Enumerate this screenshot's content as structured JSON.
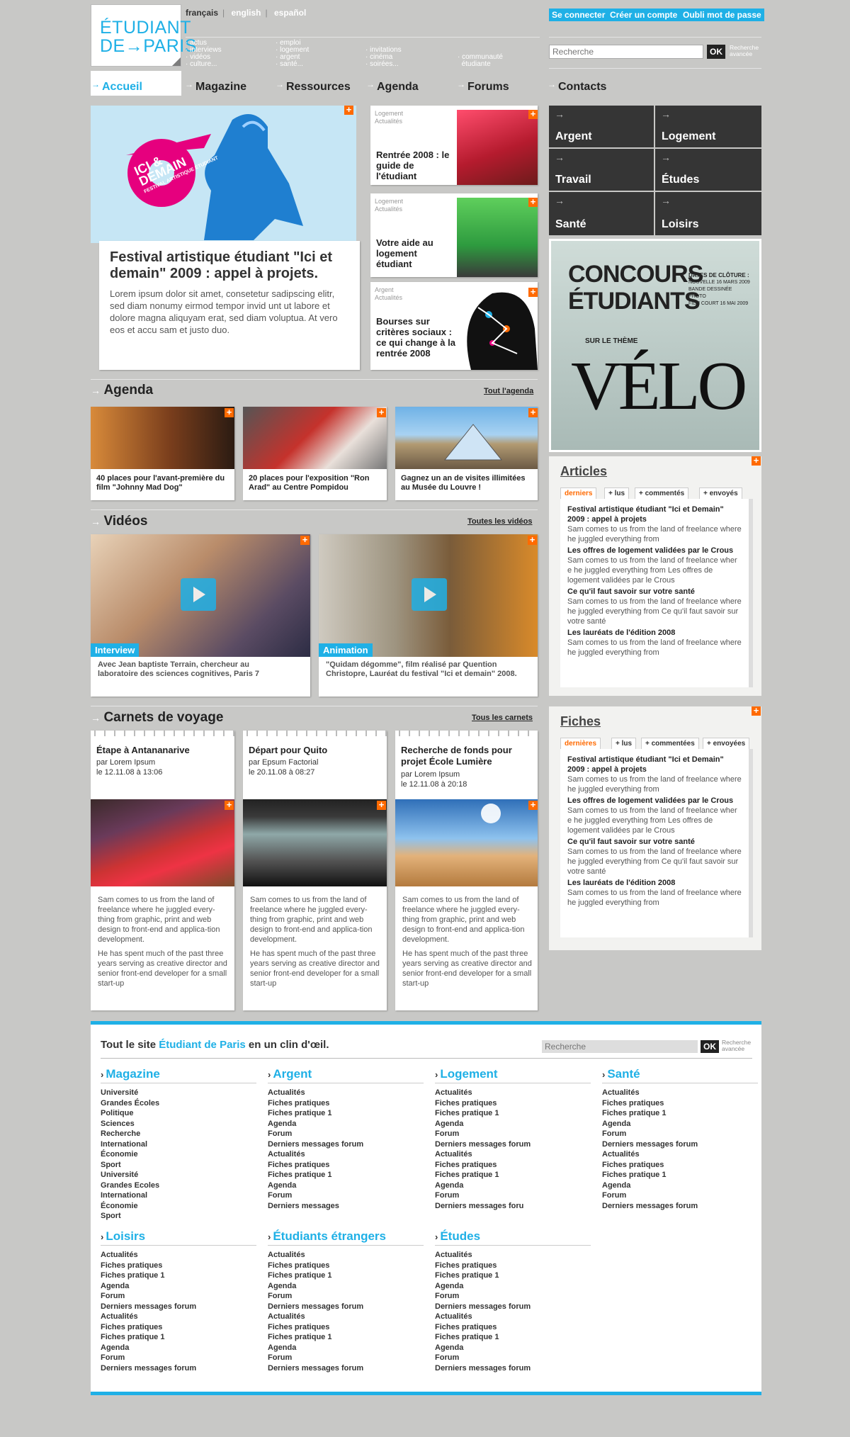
{
  "brand": {
    "line1": "ÉTUDIANT",
    "line2": "DE→PARIS"
  },
  "langs": [
    "français",
    "english",
    "español"
  ],
  "header_links": [
    [
      "actus",
      "interviews",
      "vidéos",
      "culture..."
    ],
    [
      "emploi",
      "logement",
      "argent",
      "santé..."
    ],
    [
      "invitations",
      "cinéma",
      "soirées..."
    ],
    [
      "communauté",
      "étudiante"
    ]
  ],
  "account": {
    "login": "Se connecter",
    "create": "Créer un compte",
    "forgot": "Oubli mot de passe"
  },
  "search": {
    "placeholder": "Recherche",
    "ok": "OK",
    "advanced1": "Recherche",
    "advanced2": "avancée"
  },
  "nav": [
    "Accueil",
    "Magazine",
    "Ressources",
    "Agenda",
    "Forums",
    "Contacts"
  ],
  "hero": {
    "title": "Festival artistique étudiant \"Ici et demain\" 2009 : appel à projets.",
    "body": "Lorem ipsum dolor sit amet, consetetur sadipscing elitr, sed diam nonumy eirmod tempor invid unt ut labore et dolore magna aliquyam erat, sed diam voluptua. At vero eos et accu sam et justo duo.",
    "badge1": "ICI &",
    "badge2": "DEMAIN",
    "badge3": "FESTIVAL ARTISTIQUE ÉTUDIANT"
  },
  "features": [
    {
      "cat1": "Logement",
      "cat2": "Actualités",
      "title": "Rentrée 2008 : le guide de l'étudiant"
    },
    {
      "cat1": "Logement",
      "cat2": "Actualités",
      "title": "Votre aide au logement étudiant"
    },
    {
      "cat1": "Argent",
      "cat2": "Actualités",
      "title": "Bourses sur critères sociaux : ce qui change à la rentrée 2008"
    }
  ],
  "categories": [
    "Argent",
    "Logement",
    "Travail",
    "Études",
    "Santé",
    "Loisirs"
  ],
  "ad": {
    "title1": "CONCOURS",
    "title2": "ÉTUDIANTS",
    "sub": "SUR LE THÈME",
    "word": "VÉLO",
    "dates_head": "DATES DE CLÔTURE :",
    "dates": [
      "NOUVELLE 16 MARS 2009",
      "BANDE DESSINÉE",
      "PHOTO",
      "FILM COURT 16 MAI 2009"
    ]
  },
  "agenda": {
    "title": "Agenda",
    "link": "Tout l'agenda",
    "items": [
      "40 places pour l'avant-première du film \"Johnny Mad Dog\"",
      "20 places pour l'exposition \"Ron Arad\" au Centre Pompidou",
      "Gagnez un an de visites illimitées au Musée du Louvre !"
    ]
  },
  "videos": {
    "title": "Vidéos",
    "link": "Toutes les vidéos",
    "items": [
      {
        "tag": "Interview",
        "cap": "Avec Jean baptiste Terrain, chercheur au laboratoire des sciences cognitives, Paris 7"
      },
      {
        "tag": "Animation",
        "cap": "\"Quidam dégomme\", film réalisé par Quention Christopre, Lauréat du festival \"Ici et demain\" 2008."
      }
    ]
  },
  "carnets": {
    "title": "Carnets de voyage",
    "link": "Tous les carnets",
    "items": [
      {
        "title": "Étape à Antananarive",
        "by": "par Lorem Ipsum",
        "date": "le 12.11.08 à 13:06"
      },
      {
        "title": "Départ pour Quito",
        "by": "par Epsum Factorial",
        "date": "le 20.11.08 à 08:27"
      },
      {
        "title": "Recherche de fonds pour projet École Lumière",
        "by": "par Lorem Ipsum",
        "date": "le 12.11.08 à 20:18"
      }
    ],
    "p1": "Sam comes to us from the land of freelance where he juggled every-thing from graphic, print and web design to front-end and applica-tion development.",
    "p2": "He has spent much of the past three years serving as creative director and senior front-end developer for a small start-up"
  },
  "articles": {
    "title": "Articles",
    "tabs": [
      "derniers",
      "+ lus",
      "+ commentés",
      "+ envoyés"
    ],
    "items": [
      {
        "t": "Festival artistique étudiant \"Ici et Demain\" 2009 : appel à projets",
        "d": "Sam comes to us from the land of freelance where he juggled everything from"
      },
      {
        "t": "Les offres de logement validées par le Crous",
        "d": "Sam comes to us from the land of freelance wher e he juggled everything from Les offres de logement validées par le Crous"
      },
      {
        "t": "Ce qu'il faut savoir sur votre santé",
        "d": "Sam comes to us from the land of freelance where he juggled everything from Ce qu'il faut savoir sur votre santé"
      },
      {
        "t": "Les lauréats de l'édition 2008",
        "d": "Sam comes to us from the land of freelance where he juggled everything from"
      }
    ]
  },
  "fiches": {
    "title": "Fiches",
    "tabs": [
      "dernières",
      "+ lus",
      "+ commentées",
      "+ envoyées"
    ]
  },
  "footer": {
    "intro1": "Tout le site ",
    "intro2": "Étudiant de Paris",
    "intro3": " en un clin d'œil.",
    "cols": [
      {
        "h": "Magazine",
        "items": [
          "Université",
          "Grandes Écoles",
          "Politique",
          "Sciences",
          "Recherche",
          "International",
          "Économie",
          "Sport",
          "Université",
          "Grandes Ecoles",
          "International",
          "Économie",
          "Sport"
        ]
      },
      {
        "h": "Argent",
        "items": [
          "Actualités",
          "Fiches pratiques",
          "Fiches pratique 1",
          "Agenda",
          "Forum",
          "Derniers messages forum",
          "Actualités",
          "Fiches pratiques",
          "Fiches pratique 1",
          "Agenda",
          "Forum",
          "Derniers messages"
        ]
      },
      {
        "h": "Logement",
        "items": [
          "Actualités",
          "Fiches pratiques",
          "Fiches pratique 1",
          "Agenda",
          "Forum",
          "Derniers messages forum",
          "Actualités",
          "Fiches pratiques",
          "Fiches pratique 1",
          "Agenda",
          "Forum",
          "Derniers messages foru"
        ]
      },
      {
        "h": "Santé",
        "items": [
          "Actualités",
          "Fiches pratiques",
          "Fiches pratique 1",
          "Agenda",
          "Forum",
          "Derniers messages forum",
          "Actualités",
          "Fiches pratiques",
          "Fiches pratique 1",
          "Agenda",
          "Forum",
          "Derniers messages forum"
        ]
      },
      {
        "h": "Loisirs",
        "items": [
          "Actualités",
          "Fiches pratiques",
          "Fiches pratique 1",
          "Agenda",
          "Forum",
          "Derniers messages forum",
          "Actualités",
          "Fiches pratiques",
          "Fiches pratique 1",
          "Agenda",
          "Forum",
          "Derniers messages forum"
        ]
      },
      {
        "h": "Étudiants étrangers",
        "items": [
          "Actualités",
          "Fiches pratiques",
          "Fiches pratique 1",
          "Agenda",
          "Forum",
          "Derniers messages forum",
          "Actualités",
          "Fiches pratiques",
          "Fiches pratique 1",
          "Agenda",
          "Forum",
          "Derniers messages forum"
        ]
      },
      {
        "h": "Études",
        "items": [
          "Actualités",
          "Fiches pratiques",
          "Fiches pratique 1",
          "Agenda",
          "Forum",
          "Derniers messages forum",
          "Actualités",
          "Fiches pratiques",
          "Fiches pratique 1",
          "Agenda",
          "Forum",
          "Derniers messages forum"
        ]
      }
    ]
  },
  "colors": {
    "accent": "#1fb0e6",
    "orange": "#ff6a00",
    "dark": "#353535",
    "bg": "#c8c8c6"
  }
}
